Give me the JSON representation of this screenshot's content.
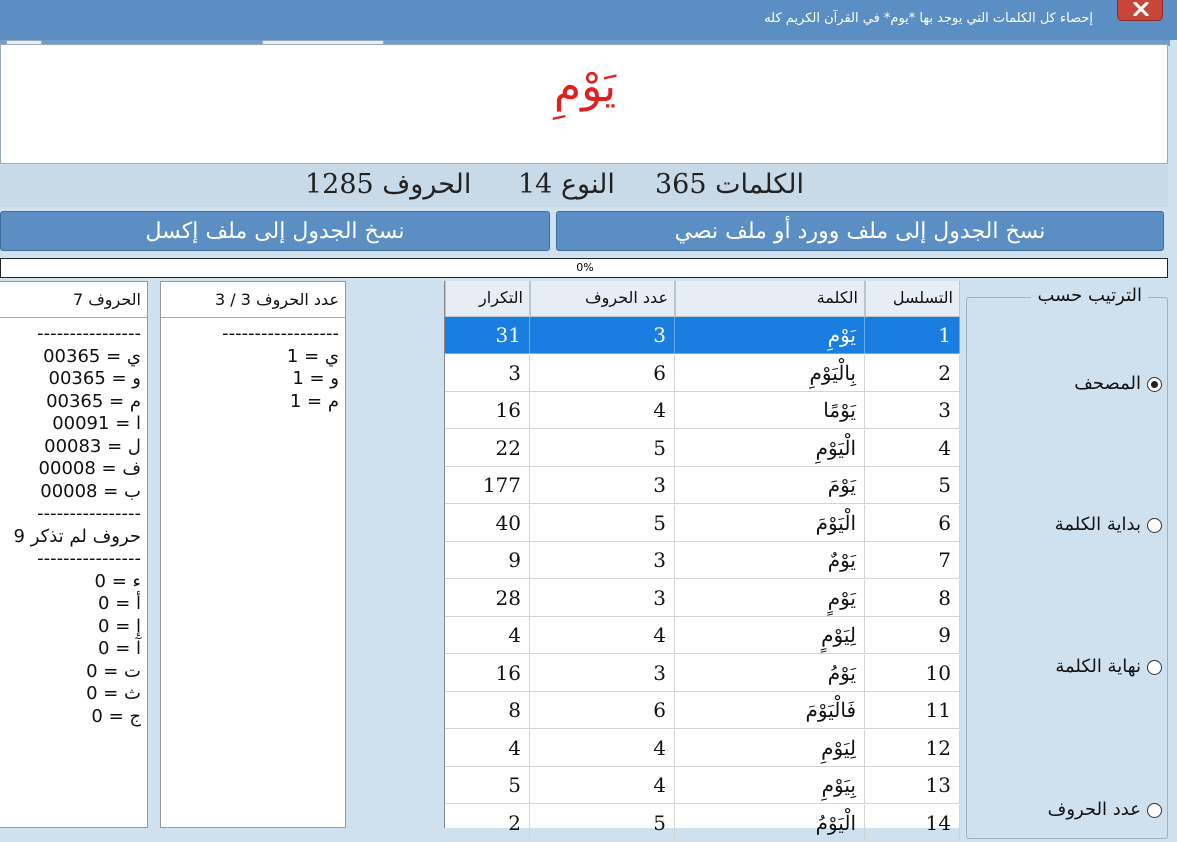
{
  "window": {
    "title": "إحصاء كل الكلمات التي يوجد بها *يوم* في القرآن الكريم كله"
  },
  "header": {
    "word": "يَوْمِ"
  },
  "stats": {
    "words_label": "الكلمات 365",
    "type_label": "النوع 14",
    "letters_label": "الحروف 1285"
  },
  "buttons": {
    "copy_word": "نسخ الجدول إلى ملف وورد أو ملف نصي",
    "copy_excel": "نسخ الجدول إلى ملف إكسل"
  },
  "progress": {
    "label": "0%",
    "value": 0
  },
  "table": {
    "columns": [
      "التسلسل",
      "الكلمة",
      "عدد الحروف",
      "التكرار"
    ],
    "rows": [
      {
        "seq": "1",
        "word": "يَوْمِ",
        "letters": "3",
        "count": "31"
      },
      {
        "seq": "2",
        "word": "بِالْيَوْمِ",
        "letters": "6",
        "count": "3"
      },
      {
        "seq": "3",
        "word": "يَوْمًا",
        "letters": "4",
        "count": "16"
      },
      {
        "seq": "4",
        "word": "الْيَوْمِ",
        "letters": "5",
        "count": "22"
      },
      {
        "seq": "5",
        "word": "يَوْمَ",
        "letters": "3",
        "count": "177"
      },
      {
        "seq": "6",
        "word": "الْيَوْمَ",
        "letters": "5",
        "count": "40"
      },
      {
        "seq": "7",
        "word": "يَوْمٌ",
        "letters": "3",
        "count": "9"
      },
      {
        "seq": "8",
        "word": "يَوْمٍ",
        "letters": "3",
        "count": "28"
      },
      {
        "seq": "9",
        "word": "لِيَوْمٍ",
        "letters": "4",
        "count": "4"
      },
      {
        "seq": "10",
        "word": "يَوْمُ",
        "letters": "3",
        "count": "16"
      },
      {
        "seq": "11",
        "word": "فَالْيَوْمَ",
        "letters": "6",
        "count": "8"
      },
      {
        "seq": "12",
        "word": "لِيَوْمِ",
        "letters": "4",
        "count": "4"
      },
      {
        "seq": "13",
        "word": "بِيَوْمِ",
        "letters": "4",
        "count": "5"
      },
      {
        "seq": "14",
        "word": "الْيَوْمُ",
        "letters": "5",
        "count": "2"
      }
    ]
  },
  "sort": {
    "title": "الترتيب حسب",
    "options": [
      {
        "label": "المصحف",
        "checked": true
      },
      {
        "label": "بداية الكلمة",
        "checked": false
      },
      {
        "label": "نهاية الكلمة",
        "checked": false
      },
      {
        "label": "عدد الحروف",
        "checked": false
      }
    ]
  },
  "letter_count_panel": {
    "header": "عدد الحروف 3 / 3",
    "lines": [
      "------------------",
      "ي = 1",
      "و = 1",
      "م = 1"
    ]
  },
  "letters_panel": {
    "header": "الحروف 7",
    "lines": [
      "----------------",
      "ي = 00365",
      "و = 00365",
      "م = 00365",
      "ا = 00091",
      "ل = 00083",
      "ف = 00008",
      "ب = 00008",
      "----------------",
      "حروف لم تذكر 9",
      "----------------",
      "ء = 0",
      "أ = 0",
      "إ = 0",
      "آ = 0",
      "ت = 0",
      "ث = 0",
      "ج = 0"
    ]
  },
  "colors": {
    "titlebar": "#5b8fc4",
    "word": "#e0201e",
    "selection": "#1a7ee0",
    "close": "#c7453a"
  }
}
